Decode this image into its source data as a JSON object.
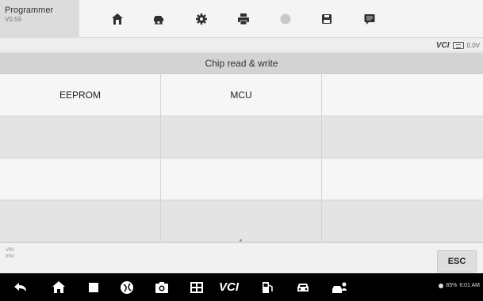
{
  "app": {
    "name": "Programmer",
    "version": "V0.59"
  },
  "toolbar": {
    "buttons": [
      {
        "name": "home-button",
        "icon": "home-icon"
      },
      {
        "name": "vehicle-swap-button",
        "icon": "car-swap-icon"
      },
      {
        "name": "settings-button",
        "icon": "gear-icon"
      },
      {
        "name": "print-button",
        "icon": "printer-icon"
      },
      {
        "name": "help-button",
        "icon": "help-icon"
      },
      {
        "name": "save-button",
        "icon": "save-icon"
      },
      {
        "name": "data-logging-button",
        "icon": "chat-icon"
      }
    ]
  },
  "vci": {
    "logo": "VCI",
    "voltage": "0.0V"
  },
  "section": {
    "title": "Chip read & write"
  },
  "grid": {
    "rows": [
      [
        "EEPROM",
        "MCU",
        ""
      ],
      [
        "",
        "",
        ""
      ],
      [
        "",
        "",
        ""
      ],
      [
        "",
        "",
        ""
      ]
    ]
  },
  "footer": {
    "info_line1": "VIN:",
    "info_line2": "Info:",
    "esc_label": "ESC"
  },
  "navbar": {
    "vci_label": "VCI",
    "status_text": "85%",
    "time": "6:01 AM"
  },
  "colors": {
    "toolbar_icon_active": "#2f2f2f",
    "toolbar_icon_disabled": "#c8c8c8",
    "header_bg": "#d3d3d3",
    "navbar_bg": "#000000"
  }
}
